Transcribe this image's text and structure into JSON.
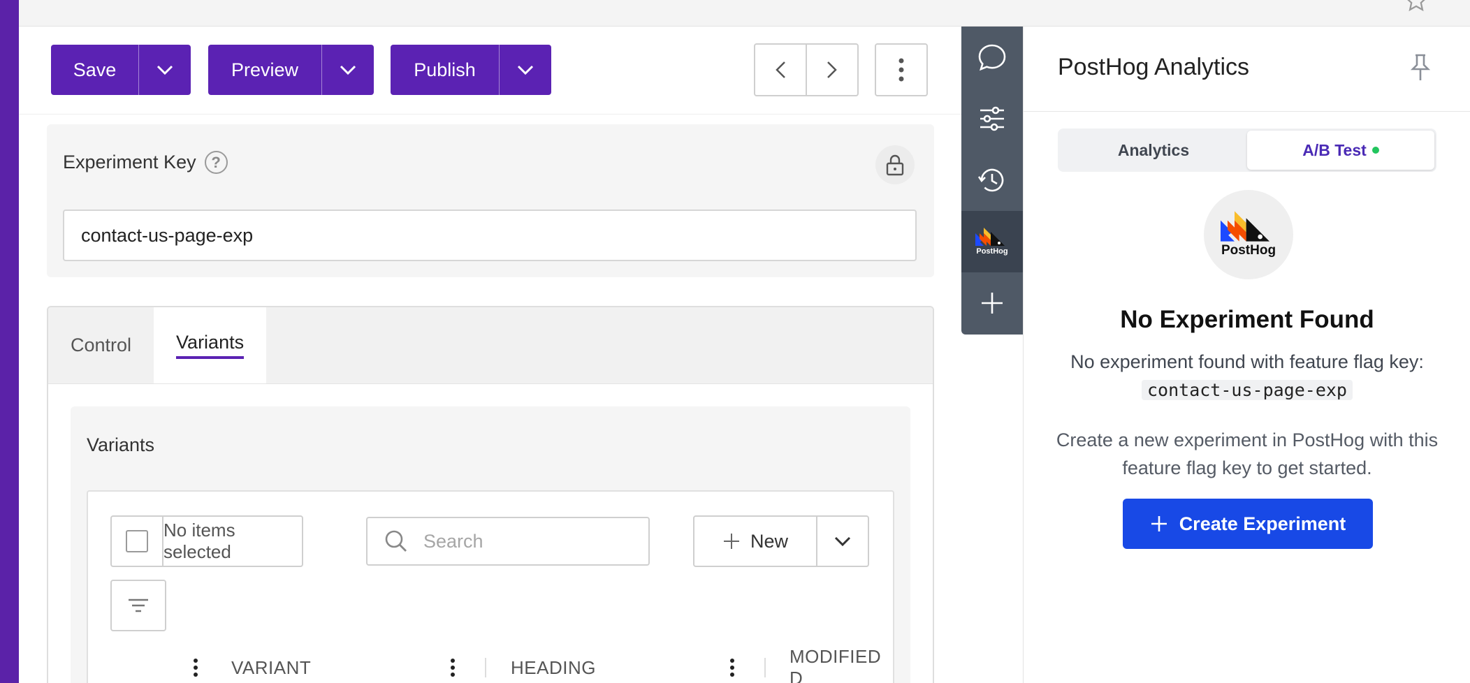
{
  "toolbar": {
    "save_label": "Save",
    "preview_label": "Preview",
    "publish_label": "Publish",
    "accent_color": "#5b22b3"
  },
  "experiment_key": {
    "label": "Experiment Key",
    "value": "contact-us-page-exp",
    "help_glyph": "?"
  },
  "tabs": [
    {
      "label": "Control"
    },
    {
      "label": "Variants"
    }
  ],
  "variants": {
    "title": "Variants",
    "selection_text": "No items selected",
    "search_placeholder": "Search",
    "new_label": "New",
    "columns": [
      "VARIANT",
      "HEADING",
      "MODIFIED D"
    ]
  },
  "rail": {
    "items": [
      "chat-icon",
      "sliders-icon",
      "history-icon",
      "posthog-logo",
      "plus-icon"
    ],
    "posthog_label": "PostHog"
  },
  "panel": {
    "title": "PostHog Analytics",
    "segments": [
      {
        "label": "Analytics"
      },
      {
        "label": "A/B Test"
      }
    ],
    "logo_label": "PostHog",
    "heading": "No Experiment Found",
    "desc_prefix": "No experiment found with feature flag key:",
    "flag_key": "contact-us-page-exp",
    "sub": "Create a new experiment in PostHog with this feature flag key to get started.",
    "create_label": "Create Experiment",
    "create_color": "#1849e6"
  }
}
